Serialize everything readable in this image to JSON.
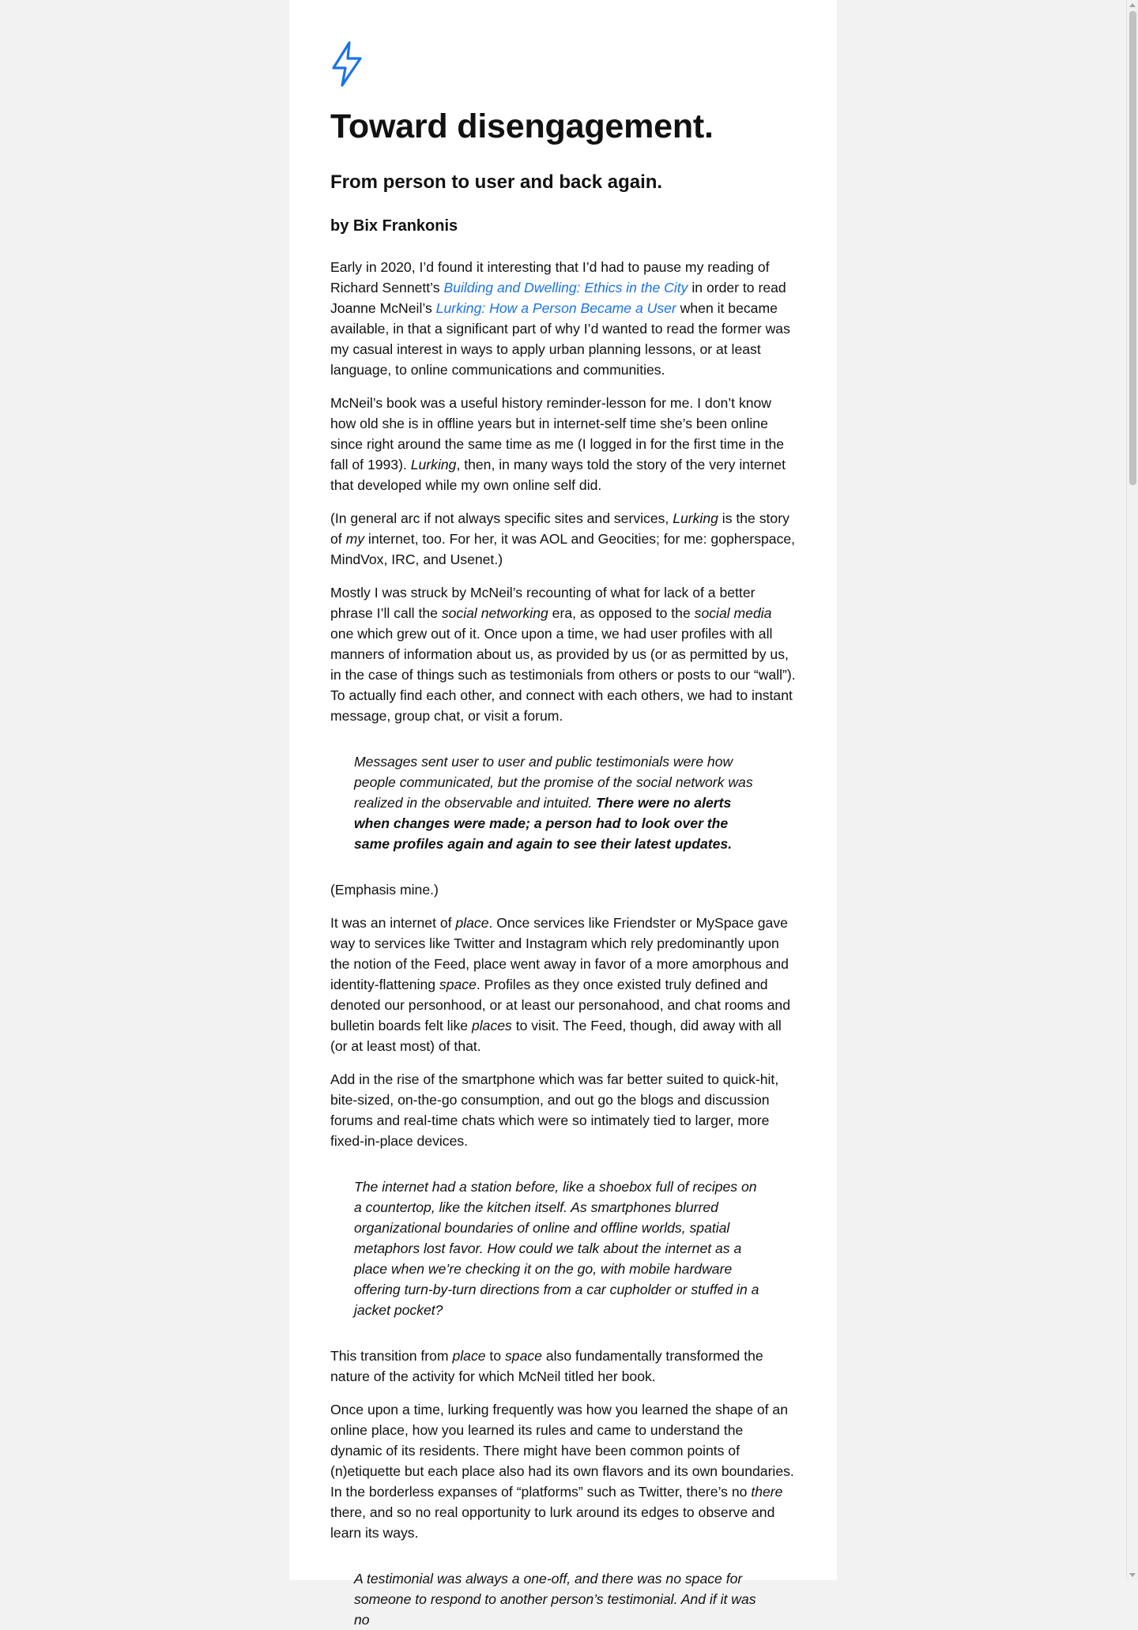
{
  "icons": {
    "logo": "lightning-bolt-icon",
    "logo_color": "#1a73e8"
  },
  "article": {
    "title": "Toward disengagement.",
    "subtitle": "From person to user and back again.",
    "byline": "by Bix Frankonis",
    "p1": {
      "t1": "Early in 2020, I’d found it interesting that I’d had to pause my reading of Richard Sennett’s ",
      "link1": "Building and Dwelling: Ethics in the City",
      "t2": " in order to read Joanne McNeil’s ",
      "link2": "Lurking: How a Person Became a User",
      "t3": " when it became available, in that a significant part of why I’d wanted to read the former was my casual interest in ways to apply urban planning lessons, or at least language, to online communications and communities."
    },
    "p2": {
      "t1": "McNeil’s book was a useful history reminder-lesson for me. I don’t know how old she is in offline years but in internet-self time she’s been online since right around the same time as me (I logged in for the first time in the fall of 1993). ",
      "em1": "Lurking",
      "t2": ", then, in many ways told the story of the very internet that developed while my own online self did."
    },
    "p3": {
      "t1": "(In general arc if not always specific sites and services, ",
      "em1": "Lurking",
      "t2": " is the story of ",
      "em2": "my",
      "t3": " internet, too. For her, it was AOL and Geocities; for me: gopherspace, MindVox, IRC, and Usenet.)"
    },
    "p4": {
      "t1": "Mostly I was struck by McNeil’s recounting of what for lack of a better phrase I’ll call the ",
      "em1": "social networking",
      "t2": " era, as opposed to the ",
      "em2": "social media",
      "t3": " one which grew out of it. Once upon a time, we had user profiles with all manners of information about us, as provided by us (or as permitted by us, in the case of things such as testimonials from others or posts to our “wall”). To actually find each other, and connect with each others, we had to instant message, group chat, or visit a forum."
    },
    "quote1": {
      "t1": "Messages sent user to user and public testimonials were how people communicated, but the promise of the social network was realized in the observable and intuited. ",
      "strong1": "There were no alerts when changes were made; a person had to look over the same profiles again and again to see their latest updates."
    },
    "p5": "(Emphasis mine.)",
    "p6": {
      "t1": "It was an internet of ",
      "em1": "place",
      "t2": ". Once services like Friendster or MySpace gave way to services like Twitter and Instagram which rely predominantly upon the notion of the Feed, place went away in favor of a more amorphous and identity-flattening ",
      "em2": "space",
      "t3": ". Profiles as they once existed truly defined and denoted our personhood, or at least our personahood, and chat rooms and bulletin boards felt like ",
      "em3": "places",
      "t4": " to visit. The Feed, though, did away with all (or at least most) of that."
    },
    "p7": "Add in the rise of the smartphone which was far better suited to quick-hit, bite-sized, on-the-go consumption, and out go the blogs and discussion forums and real-time chats which were so intimately tied to larger, more fixed-in-place devices.",
    "quote2": "The internet had a station before, like a shoebox full of recipes on a countertop, like the kitchen itself. As smartphones blurred organizational boundaries of online and offline worlds, spatial metaphors lost favor. How could we talk about the internet as a place when we’re checking it on the go, with mobile hardware offering turn-by-turn directions from a car cupholder or stuffed in a jacket pocket?",
    "p8": {
      "t1": "This transition from ",
      "em1": "place",
      "t2": " to ",
      "em2": "space",
      "t3": " also fundamentally transformed the nature of the activity for which McNeil titled her book."
    },
    "p9": {
      "t1": "Once upon a time, lurking frequently was how you learned the shape of an online place, how you learned its rules and came to understand the dynamic of its residents. There might have been common points of (n)etiquette but each place also had its own flavors and its own boundaries. In the borderless expanses of “platforms” such as Twitter, there’s no ",
      "em1": "there",
      "t2": " there, and so no real opportunity to lurk around its edges to observe and learn its ways."
    },
    "quote3": "A testimonial was always a one-off, and there was no space for someone to respond to another person’s testimonial. And if it was no"
  }
}
